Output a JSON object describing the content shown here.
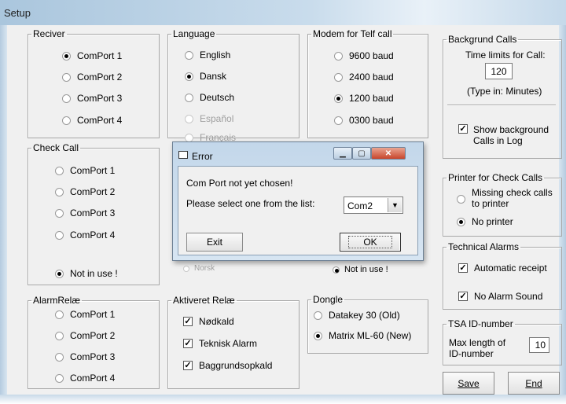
{
  "window": {
    "title": "Setup"
  },
  "reciver": {
    "legend": "Reciver",
    "options": [
      "ComPort 1",
      "ComPort 2",
      "ComPort 3",
      "ComPort 4"
    ],
    "selected": "ComPort 1"
  },
  "language": {
    "legend": "Language",
    "options": [
      "English",
      "Dansk",
      "Deutsch",
      "Español",
      "Français",
      "Norsk"
    ],
    "selected": "Dansk",
    "disabled": [
      "Español",
      "Français",
      "Norsk"
    ]
  },
  "modem": {
    "legend": "Modem for Telf call",
    "options": [
      "9600 baud",
      "2400 baud",
      "1200 baud",
      "0300 baud",
      "Not in use !"
    ],
    "selected": "1200 baud"
  },
  "background_calls": {
    "legend": "Backgrund Calls",
    "time_label": "Time limits for Call:",
    "time_value": "120",
    "unit_label": "(Type in: Minutes)",
    "show_log_label": "Show background Calls in Log",
    "show_log_checked": true
  },
  "check_call": {
    "legend": "Check Call",
    "options": [
      "ComPort 1",
      "ComPort 2",
      "ComPort 3",
      "ComPort 4",
      "Not in use !"
    ],
    "selected": "Not in use !"
  },
  "printer": {
    "legend": "Printer for Check Calls",
    "options": [
      "Missing check calls to printer",
      "No printer"
    ],
    "selected": "No printer"
  },
  "technical_alarms": {
    "legend": "Technical Alarms",
    "automatic_receipt": "Automatic receipt",
    "automatic_receipt_checked": true,
    "no_alarm_sound": "No Alarm Sound",
    "no_alarm_sound_checked": true
  },
  "alarm_relae": {
    "legend": "AlarmRelæ",
    "options": [
      "ComPort 1",
      "ComPort 2",
      "ComPort 3",
      "ComPort 4"
    ]
  },
  "aktiveret_relae": {
    "legend": "Aktiveret Relæ",
    "items": [
      "Nødkald",
      "Teknisk Alarm",
      "Baggrundsopkald"
    ],
    "checked": [
      true,
      true,
      true
    ]
  },
  "dongle": {
    "legend": "Dongle",
    "options": [
      "Datakey 30 (Old)",
      "Matrix ML-60 (New)"
    ],
    "selected": "Matrix ML-60 (New)"
  },
  "tsa": {
    "legend": "TSA ID-number",
    "max_label": "Max length of ID-number",
    "value": "10"
  },
  "buttons": {
    "save": "Save",
    "end": "End"
  },
  "error_dialog": {
    "title": "Error",
    "message": "Com Port not yet chosen!",
    "prompt": "Please select one from the list:",
    "combo_value": "Com2",
    "exit": "Exit",
    "ok": "OK"
  },
  "check_mark": "✓"
}
